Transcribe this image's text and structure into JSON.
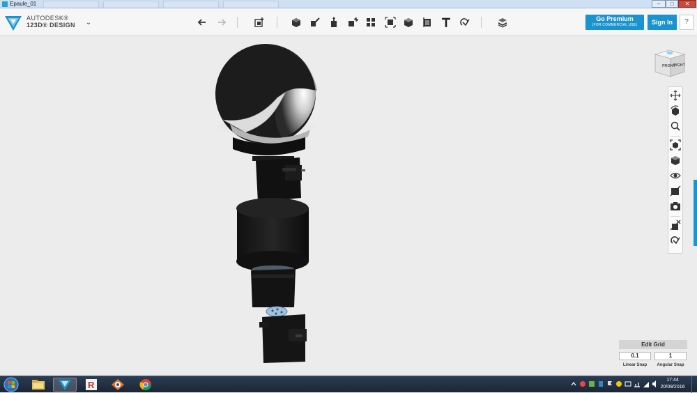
{
  "window": {
    "title": "Epaule_01"
  },
  "app": {
    "brand_line1": "AUTODESK®",
    "brand_line2": "123D® DESIGN"
  },
  "toolbar": {
    "tools": [
      "undo-icon",
      "redo-icon",
      "transform-icon",
      "primitives-icon",
      "sketch-icon",
      "construct-icon",
      "modify-icon",
      "pattern-icon",
      "grouping-icon",
      "combine-icon",
      "measure-icon",
      "text-icon",
      "snap-icon",
      "material-icon"
    ]
  },
  "premium": {
    "label": "Go Premium",
    "sublabel": "(FOR COMMERCIAL USE)"
  },
  "signin": {
    "label": "Sign In"
  },
  "help": {
    "label": "?"
  },
  "viewcube": {
    "front": "FRONT",
    "right": "RIGHT"
  },
  "navbar": {
    "tools": [
      "pan-icon",
      "orbit-icon",
      "zoom-icon",
      "fit-icon",
      "view-icon",
      "visibility-icon",
      "hide-icon",
      "screenshot-icon",
      "materials-toggle-icon",
      "snap-toggle-icon"
    ]
  },
  "edit_grid": {
    "header": "Edit Grid",
    "linear_value": "0.1",
    "linear_label": "Linear Snap",
    "angular_value": "1",
    "angular_label": "Angular Snap"
  },
  "taskbar": {
    "apps": [
      "explorer-icon",
      "123d-design-icon",
      "revit-icon",
      "media-icon",
      "chrome-icon"
    ],
    "time": "17:44",
    "date": "20/09/2016"
  },
  "colors": {
    "accent": "#1b93cf",
    "titlebar": "#cfe0f2",
    "taskbar": "#1f2b3d"
  }
}
